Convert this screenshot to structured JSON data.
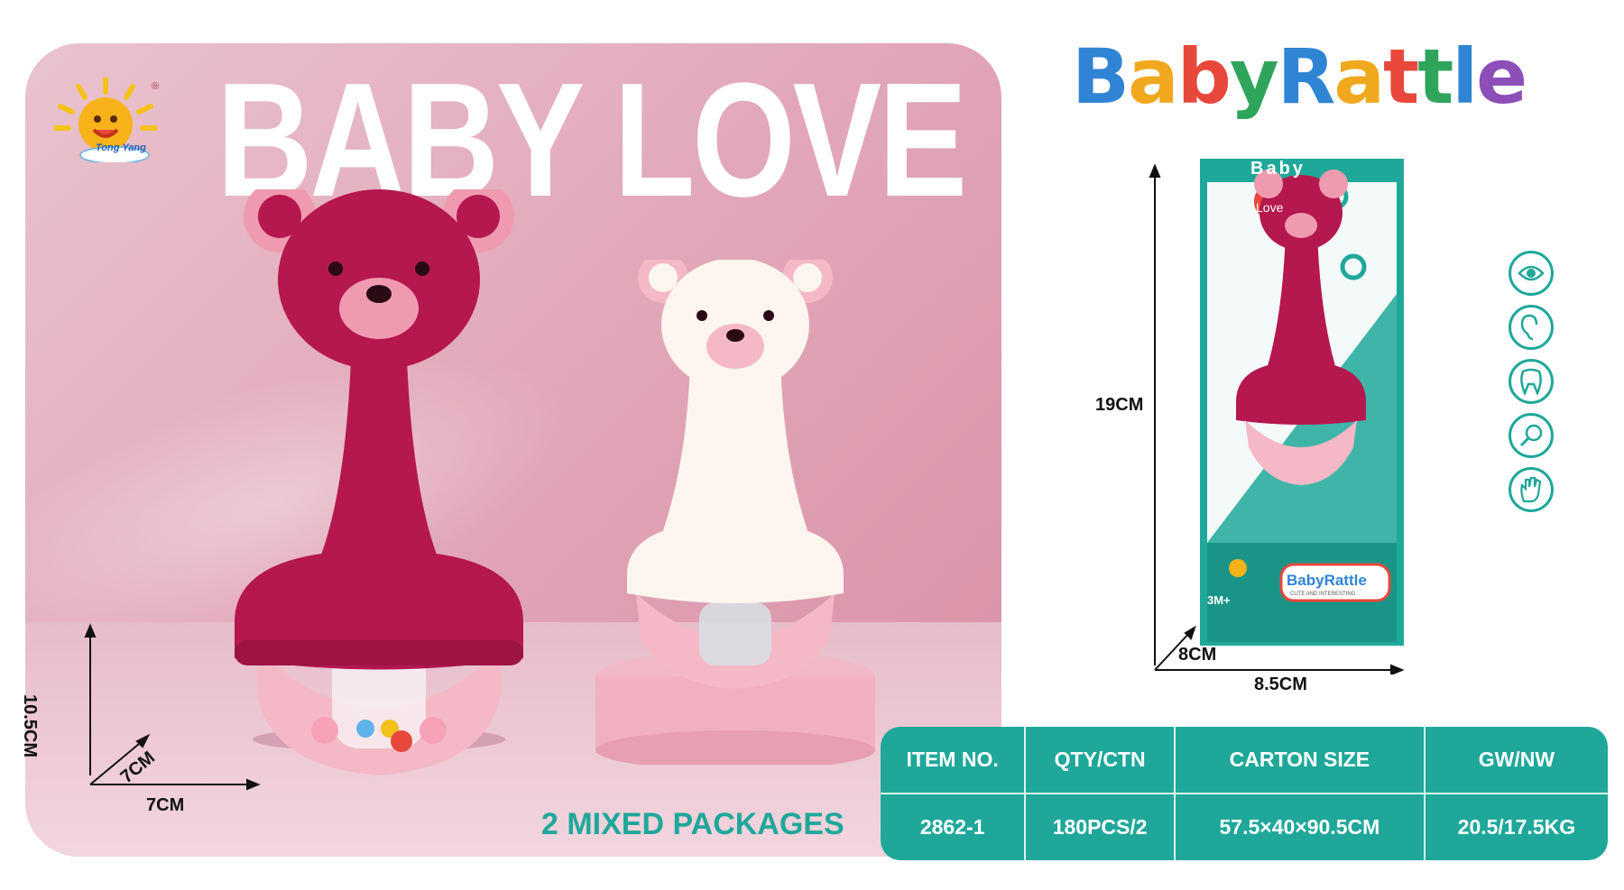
{
  "colors": {
    "teal": "#1fa89a",
    "magenta": "#b5174f",
    "pink": "#f4b8c6",
    "cream": "#fdf6ee"
  },
  "logo": {
    "brand_text": "Tong Yang",
    "registered_mark": "®"
  },
  "headline": "BABY LOVE",
  "mixed_packages": "2 MIXED PACKAGES",
  "brand_title": {
    "letters": [
      "B",
      "a",
      "b",
      "y",
      "R",
      "a",
      "t",
      "t",
      "l",
      "e"
    ],
    "colors": [
      "#2f84d4",
      "#f0a81f",
      "#e8483b",
      "#2fa55c",
      "#2f84d4",
      "#f0a81f",
      "#e8483b",
      "#2fa55c",
      "#2f84d4",
      "#8c4fb8"
    ]
  },
  "product_dims": {
    "height": "10.5CM",
    "depth": "7CM",
    "width": "7CM"
  },
  "box": {
    "top_label": "Baby",
    "love_tag": "Love",
    "age": "3M+",
    "box_brand": "BabyRattle",
    "box_tagline": "CUTE AND INTERESTING",
    "height": "19CM",
    "depth": "8CM",
    "width": "8.5CM"
  },
  "feature_icons": [
    "eye-icon",
    "ear-icon",
    "tooth-icon",
    "rattle-icon",
    "hand-icon"
  ],
  "spec_table": {
    "headers": [
      "ITEM NO.",
      "QTY/CTN",
      "CARTON SIZE",
      "GW/NW"
    ],
    "values": [
      "2862-1",
      "180PCS/2",
      "57.5×40×90.5CM",
      "20.5/17.5KG"
    ]
  }
}
